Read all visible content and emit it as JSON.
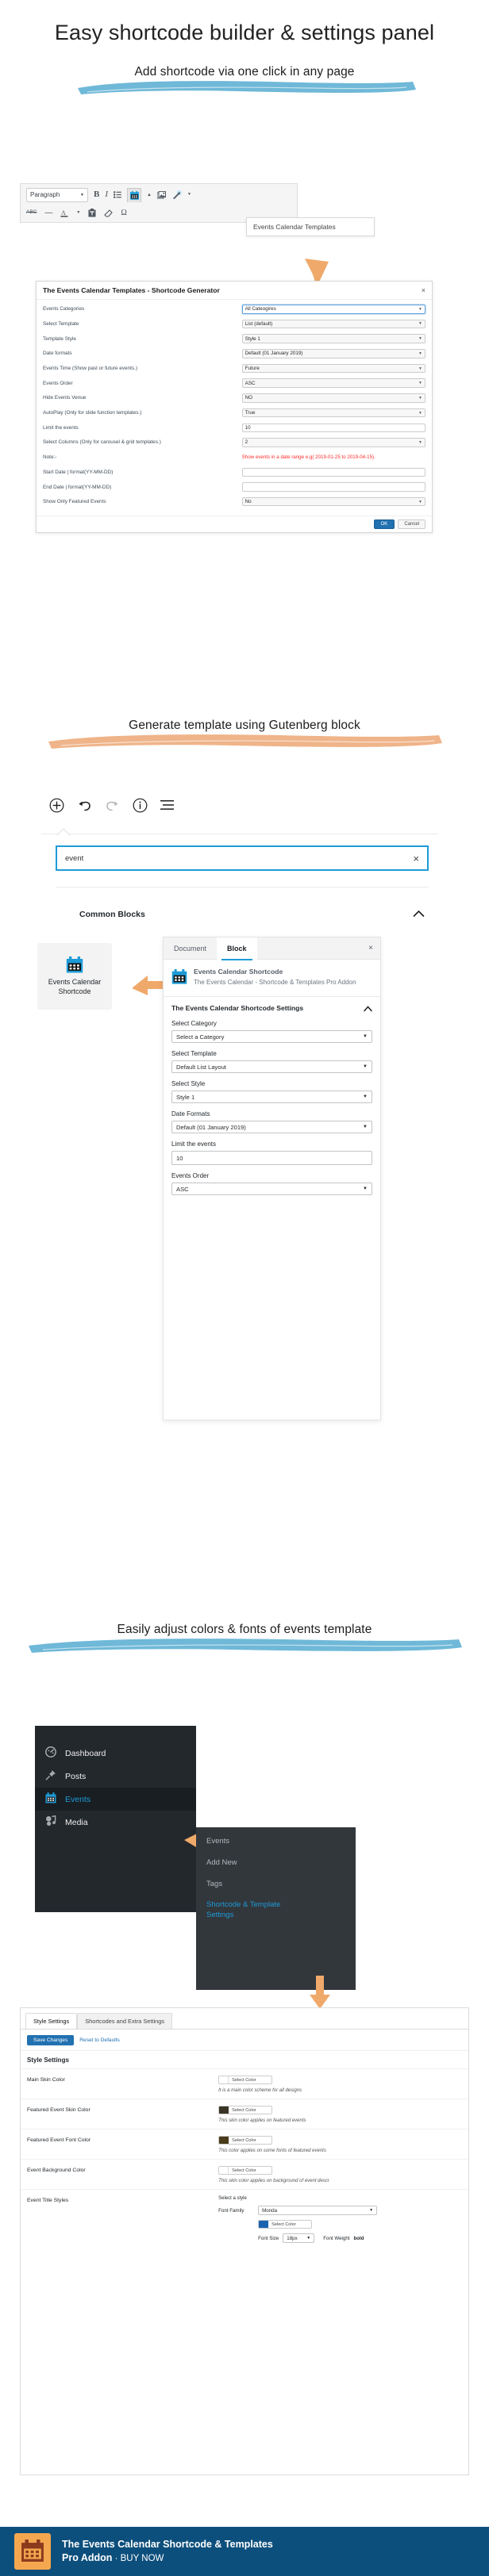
{
  "page": {
    "main_title": "Easy shortcode builder & settings panel"
  },
  "sections": [
    {
      "banner": "Add shortcode via one click in any page",
      "banner_color": "#6fb8d8"
    },
    {
      "banner": "Generate template using Gutenberg block",
      "banner_color": "#efb489"
    },
    {
      "banner": "Easily adjust colors & fonts of events template",
      "banner_color": "#6fb8d8"
    }
  ],
  "classic_editor": {
    "paragraph_select": "Paragraph",
    "tooltip": "Events Calendar Templates",
    "icons": {
      "bold": "B",
      "italic": "I",
      "bullet_list": "bullet-list-icon",
      "strikethrough": "ABC",
      "horizontal_rule": "—",
      "text_color": "A",
      "paste": "paste-icon",
      "clear_formatting": "eraser-icon",
      "special_character": "Ω",
      "calendar": "calendar-icon",
      "media": "media-icon",
      "magic_wand": "wand-icon"
    }
  },
  "shortcode_generator": {
    "title": "The Events Calendar Templates - Shortcode Generator",
    "close": "×",
    "rows": [
      {
        "label": "Events Categories",
        "value": "All Cateogires",
        "type": "select",
        "focused": true
      },
      {
        "label": "Select Template",
        "value": "List (default)",
        "type": "select"
      },
      {
        "label": "Template Style",
        "value": "Style 1",
        "type": "select"
      },
      {
        "label": "Date formats",
        "value": "Default (01 January 2019)",
        "type": "select"
      },
      {
        "label": "Events Time (Show past or future events.)",
        "value": "Future",
        "type": "select"
      },
      {
        "label": "Events Order",
        "value": "ASC",
        "type": "select"
      },
      {
        "label": "Hide Events Venue",
        "value": "NO",
        "type": "select"
      },
      {
        "label": "AutoPlay (Only for slide function templates.)",
        "value": "True",
        "type": "select"
      },
      {
        "label": "Limit the events",
        "value": "10",
        "type": "text"
      },
      {
        "label": "Select Columns (Only for carousel & grid templates.)",
        "value": "2",
        "type": "select"
      },
      {
        "label": "Note:-",
        "value": "Show events in a date range e.g( 2019-01-25 to 2019-04-15).",
        "type": "note"
      },
      {
        "label": "Start Date | format(YY-MM-DD)",
        "value": "",
        "type": "text"
      },
      {
        "label": "End Date | format(YY-MM-DD)",
        "value": "",
        "type": "text"
      },
      {
        "label": "Show Only Featured Events",
        "value": "No",
        "type": "select"
      }
    ],
    "ok_label": "OK",
    "cancel_label": "Cancel"
  },
  "gutenberg": {
    "toolbar_icons": [
      "add-block-icon",
      "undo-icon",
      "redo-icon",
      "info-icon",
      "block-navigation-icon"
    ],
    "search_value": "event",
    "search_clear": "×",
    "section_title": "Common Blocks",
    "block_tile_label": "Events Calendar Shortcode",
    "sidebar": {
      "tab_document": "Document",
      "tab_block": "Block",
      "close": "×",
      "block_title": "Events Calendar Shortcode",
      "block_desc": "The Events Calendar - Shortcode & Templates Pro Addon",
      "settings_title": "The Events Calendar Shortcode Settings",
      "fields": [
        {
          "label": "Select Category",
          "value": "Select a Category"
        },
        {
          "label": "Select Template",
          "value": "Default List Layout"
        },
        {
          "label": "Select Style",
          "value": "Style 1"
        },
        {
          "label": "Date Formats",
          "value": "Default (01 January 2019)"
        },
        {
          "label": "Limit the events",
          "value": "10"
        },
        {
          "label": "Events Order",
          "value": "ASC"
        }
      ]
    }
  },
  "wp_admin": {
    "menu": [
      {
        "label": "Dashboard",
        "icon": "dashboard-icon"
      },
      {
        "label": "Posts",
        "icon": "pin-icon"
      },
      {
        "label": "Events",
        "icon": "calendar-icon",
        "current": true
      },
      {
        "label": "Media",
        "icon": "media-icon"
      }
    ],
    "submenu": [
      {
        "label": "Events"
      },
      {
        "label": "Add New"
      },
      {
        "label": "Tags"
      },
      {
        "label": "Shortcode & Template Settings",
        "current": true
      }
    ]
  },
  "style_settings": {
    "tabs": [
      {
        "label": "Style Settings",
        "active": true
      },
      {
        "label": "Shortcodes and Extra Settings",
        "active": false
      }
    ],
    "save_label": "Save Changes",
    "reset_label": "Reset to Defaults",
    "heading": "Style Settings",
    "rows": [
      {
        "label": "Main Skin Color",
        "control": "color",
        "swatch": "#ffffff",
        "button_label": "Select Color",
        "help": "It is a main color scheme for all designs"
      },
      {
        "label": "Featured Event Skin Color",
        "control": "color",
        "swatch": "#3a3426",
        "button_label": "Select Color",
        "help": "This skin color applies on featured events"
      },
      {
        "label": "Featured Event Font Color",
        "control": "color",
        "swatch": "#4a3b1a",
        "button_label": "Select Color",
        "help": "This color applies on some fonts of featured events"
      },
      {
        "label": "Event Background Color",
        "control": "color",
        "swatch": "#ffffff",
        "button_label": "Select Color",
        "help": "This skin color applies on background of event descr"
      }
    ],
    "title_styles": {
      "label": "Event Title Styles",
      "hint": "Select a style",
      "font_family_label": "Font Family",
      "font_family_value": "Monda",
      "color_button_label": "Select Color",
      "color_swatch": "#1b63b0",
      "font_size_label": "Font Size",
      "font_size_value": "18px",
      "font_weight_label": "Font Weight",
      "font_weight_value": "bold"
    }
  },
  "footer": {
    "line1": "The Events Calendar Shortcode & Templates",
    "line2_bold": "Pro Addon",
    "line2_rest": " · BUY NOW",
    "logo": "calendar-icon",
    "bg_color": "#0d4f7c",
    "logo_color": "#f5a74f"
  }
}
